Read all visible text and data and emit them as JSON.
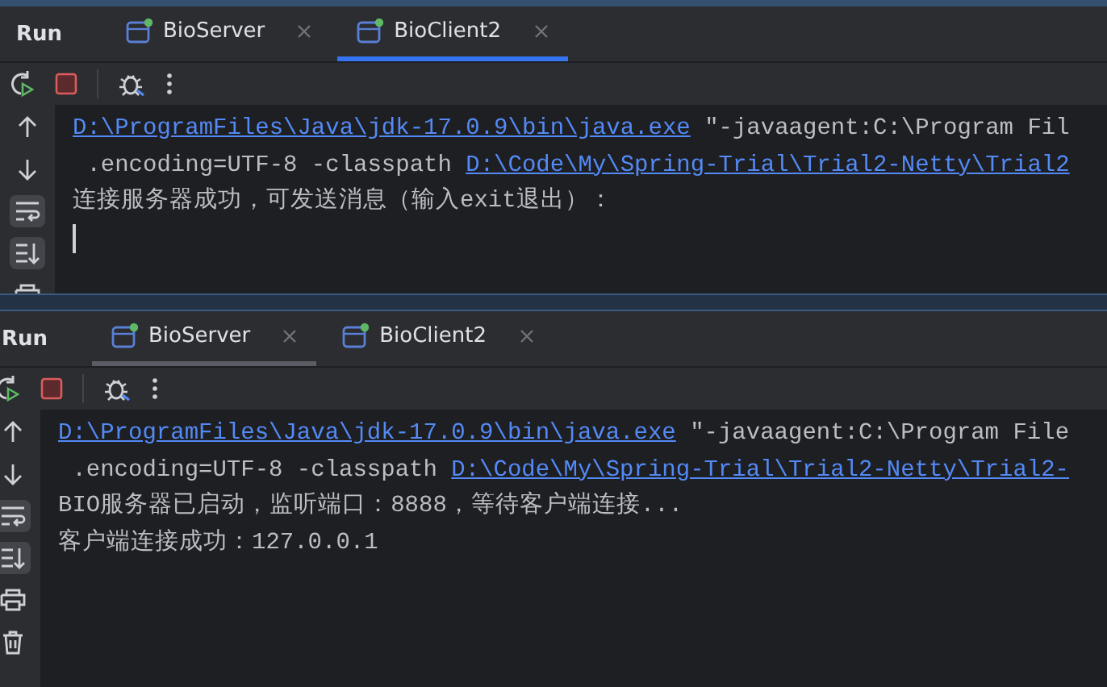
{
  "panels": [
    {
      "title": "Run",
      "focused": true,
      "input_caret": true,
      "tabs": [
        {
          "label": "BioServer",
          "selected": false
        },
        {
          "label": "BioClient2",
          "selected": true
        }
      ],
      "lines": [
        {
          "segments": [
            {
              "text": "D:\\ProgramFiles\\Java\\jdk-17.0.9\\bin\\java.exe",
              "link": true
            },
            {
              "text": " \"-javaagent:C:\\Program Fil",
              "link": false
            }
          ]
        },
        {
          "segments": [
            {
              "text": " .encoding=UTF-8 -classpath ",
              "link": false
            },
            {
              "text": "D:\\Code\\My\\Spring-Trial\\Trial2-Netty\\Trial2",
              "link": true
            }
          ]
        },
        {
          "segments": [
            {
              "text": "连接服务器成功，可发送消息（输入exit退出）：",
              "link": false
            }
          ]
        }
      ]
    },
    {
      "title": "Run",
      "focused": false,
      "input_caret": false,
      "tabs": [
        {
          "label": "BioServer",
          "selected": true
        },
        {
          "label": "BioClient2",
          "selected": false
        }
      ],
      "lines": [
        {
          "segments": [
            {
              "text": "D:\\ProgramFiles\\Java\\jdk-17.0.9\\bin\\java.exe",
              "link": true
            },
            {
              "text": " \"-javaagent:C:\\Program File",
              "link": false
            }
          ]
        },
        {
          "segments": [
            {
              "text": " .encoding=UTF-8 -classpath ",
              "link": false
            },
            {
              "text": "D:\\Code\\My\\Spring-Trial\\Trial2-Netty\\Trial2-",
              "link": true
            }
          ]
        },
        {
          "segments": [
            {
              "text": "BIO服务器已启动，监听端口：8888，等待客户端连接...",
              "link": false
            }
          ]
        },
        {
          "segments": [
            {
              "text": "客户端连接成功：127.0.0.1",
              "link": false
            }
          ]
        }
      ]
    }
  ]
}
